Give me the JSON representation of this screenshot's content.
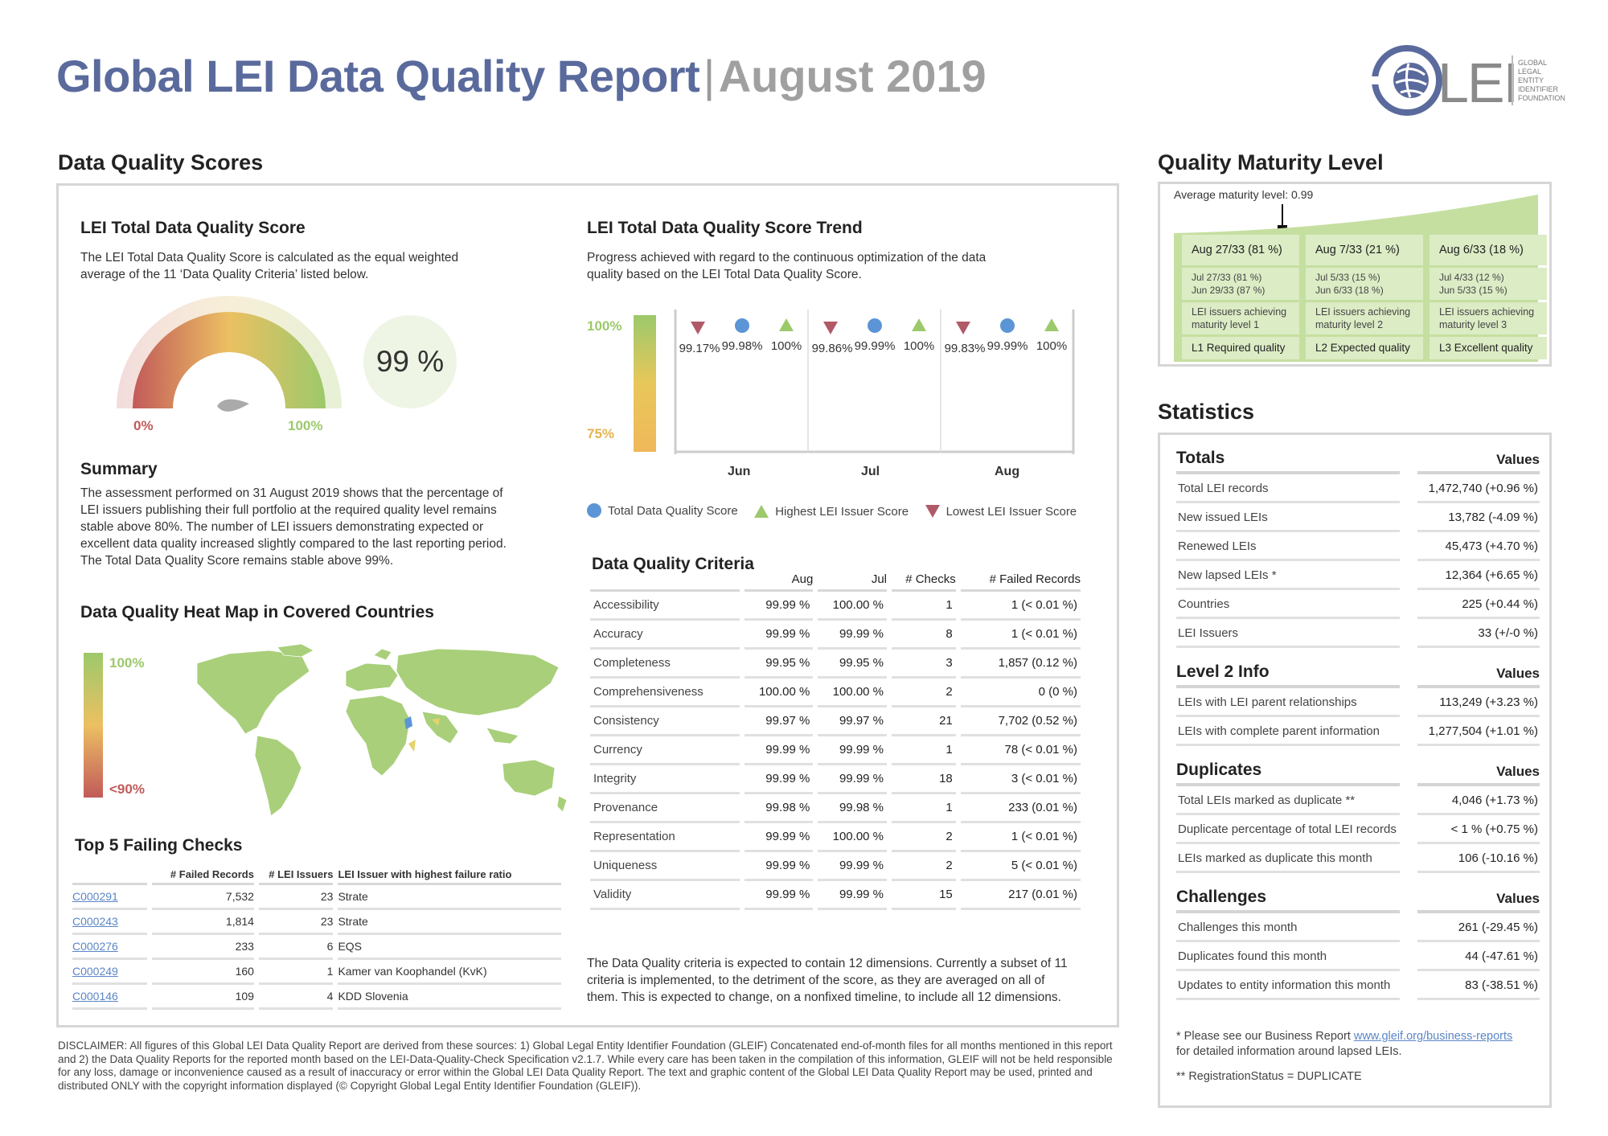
{
  "header": {
    "title": "Global LEI Data Quality Report",
    "separator": "|",
    "month": "August 2019",
    "logo_text": "LEI",
    "logo_sub": [
      "GLOBAL",
      "LEGAL",
      "ENTITY",
      "IDENTIFIER",
      "FOUNDATION"
    ]
  },
  "dq_scores": {
    "heading": "Data Quality Scores",
    "total_score": {
      "title": "LEI Total Data Quality Score",
      "desc": "The LEI Total Data Quality Score is calculated as the equal weighted average of the 11 ‘Data Quality Criteria’ listed below.",
      "gauge_min": "0%",
      "gauge_max": "100%",
      "value_label": "99 %",
      "value": 0.99
    },
    "summary": {
      "title": "Summary",
      "text": "The assessment performed on 31 August 2019 shows that the percentage of LEI issuers publishing their full portfolio at the required quality level remains stable above 80%. The number of LEI issuers demonstrating expected or excellent data quality increased slightly compared to the last reporting period. The Total Data Quality Score remains stable above 99%."
    },
    "heatmap": {
      "title": "Data Quality Heat Map in Covered Countries",
      "scale_top": "100%",
      "scale_bottom": "<90%"
    },
    "top5": {
      "title": "Top 5 Failing Checks",
      "columns": [
        "# Failed Records",
        "# LEI Issuers",
        "LEI Issuer with highest failure ratio"
      ],
      "rows": [
        {
          "check": "C000291",
          "failed": "7,532",
          "issuers": "23",
          "issuer": "Strate"
        },
        {
          "check": "C000243",
          "failed": "1,814",
          "issuers": "23",
          "issuer": "Strate"
        },
        {
          "check": "C000276",
          "failed": "233",
          "issuers": "6",
          "issuer": "EQS"
        },
        {
          "check": "C000249",
          "failed": "160",
          "issuers": "1",
          "issuer": "Kamer van Koophandel (KvK)"
        },
        {
          "check": "C000146",
          "failed": "109",
          "issuers": "4",
          "issuer": "KDD Slovenia"
        }
      ]
    },
    "trend": {
      "title": "LEI Total Data Quality Score Trend",
      "desc": "Progress achieved with regard to the continuous optimization of the data quality based on the LEI Total Data Quality Score.",
      "scale_top": "100%",
      "scale_bottom": "75%",
      "months": [
        "Jun",
        "Jul",
        "Aug"
      ],
      "legend": [
        "Total Data Quality Score",
        "Highest LEI Issuer Score",
        "Lowest LEI Issuer Score"
      ],
      "points": [
        {
          "low": "99.17%",
          "total": "99.98%",
          "high": "100%"
        },
        {
          "low": "99.86%",
          "total": "99.99%",
          "high": "100%"
        },
        {
          "low": "99.83%",
          "total": "99.99%",
          "high": "100%"
        }
      ]
    },
    "criteria": {
      "title": "Data Quality Criteria",
      "columns": [
        "Aug",
        "Jul",
        "# Checks",
        "# Failed Records"
      ],
      "rows": [
        {
          "name": "Accessibility",
          "aug": "99.99 %",
          "jul": "100.00 %",
          "checks": "1",
          "failed": "1 (< 0.01 %)"
        },
        {
          "name": "Accuracy",
          "aug": "99.99 %",
          "jul": "99.99 %",
          "checks": "8",
          "failed": "1 (< 0.01 %)"
        },
        {
          "name": "Completeness",
          "aug": "99.95 %",
          "jul": "99.95 %",
          "checks": "3",
          "failed": "1,857 (0.12 %)"
        },
        {
          "name": "Comprehensiveness",
          "aug": "100.00 %",
          "jul": "100.00 %",
          "checks": "2",
          "failed": "0 (0 %)"
        },
        {
          "name": "Consistency",
          "aug": "99.97 %",
          "jul": "99.97 %",
          "checks": "21",
          "failed": "7,702 (0.52 %)"
        },
        {
          "name": "Currency",
          "aug": "99.99 %",
          "jul": "99.99 %",
          "checks": "1",
          "failed": "78 (< 0.01 %)"
        },
        {
          "name": "Integrity",
          "aug": "99.99 %",
          "jul": "99.99 %",
          "checks": "18",
          "failed": "3 (< 0.01 %)"
        },
        {
          "name": "Provenance",
          "aug": "99.98 %",
          "jul": "99.98 %",
          "checks": "1",
          "failed": "233 (0.01 %)"
        },
        {
          "name": "Representation",
          "aug": "99.99 %",
          "jul": "100.00 %",
          "checks": "2",
          "failed": "1 (< 0.01 %)"
        },
        {
          "name": "Uniqueness",
          "aug": "99.99 %",
          "jul": "99.99 %",
          "checks": "2",
          "failed": "5 (< 0.01 %)"
        },
        {
          "name": "Validity",
          "aug": "99.99 %",
          "jul": "99.99 %",
          "checks": "15",
          "failed": "217 (0.01 %)"
        }
      ],
      "note": "The Data Quality criteria is expected to contain 12 dimensions. Currently a subset of 11 criteria is implemented, to the detriment of the score, as they are averaged on all of them. This is expected to change, on a nonfixed timeline, to include all 12 dimensions."
    }
  },
  "maturity": {
    "heading": "Quality Maturity Level",
    "average": "Average maturity level: 0.99",
    "levels": [
      {
        "head": "Aug 27/33 (81 %)",
        "hist1": "Jul 27/33 (81 %)",
        "hist2": "Jun 29/33 (87 %)",
        "desc1": "LEI issuers achieving",
        "desc2": "maturity level 1",
        "label": "L1 Required quality"
      },
      {
        "head": "Aug 7/33 (21 %)",
        "hist1": "Jul 5/33 (15 %)",
        "hist2": "Jun 6/33 (18 %)",
        "desc1": "LEI issuers achieving",
        "desc2": "maturity level 2",
        "label": "L2 Expected quality"
      },
      {
        "head": "Aug 6/33 (18 %)",
        "hist1": "Jul 4/33 (12 %)",
        "hist2": "Jun 5/33 (15 %)",
        "desc1": "LEI issuers achieving",
        "desc2": "maturity level 3",
        "label": "L3 Excellent quality"
      }
    ]
  },
  "statistics": {
    "heading": "Statistics",
    "values_label": "Values",
    "groups": [
      {
        "title": "Totals",
        "rows": [
          {
            "label": "Total LEI records",
            "value": "1,472,740 (+0.96 %)"
          },
          {
            "label": "New issued LEIs",
            "value": "13,782 (-4.09 %)"
          },
          {
            "label": "Renewed LEIs",
            "value": "45,473 (+4.70 %)"
          },
          {
            "label": "New lapsed LEIs *",
            "value": "12,364 (+6.65 %)"
          },
          {
            "label": "Countries",
            "value": "225 (+0.44 %)"
          },
          {
            "label": "LEI Issuers",
            "value": "33 (+/-0 %)"
          }
        ]
      },
      {
        "title": "Level 2 Info",
        "rows": [
          {
            "label": "LEIs with LEI parent relationships",
            "value": "113,249 (+3.23 %)"
          },
          {
            "label": "LEIs with complete parent information",
            "value": "1,277,504 (+1.01 %)"
          }
        ]
      },
      {
        "title": "Duplicates",
        "rows": [
          {
            "label": "Total LEIs marked as duplicate **",
            "value": "4,046 (+1.73 %)"
          },
          {
            "label": "Duplicate percentage of total LEI records",
            "value": "< 1 % (+0.75 %)"
          },
          {
            "label": "LEIs marked as duplicate this month",
            "value": "106 (-10.16 %)"
          }
        ]
      },
      {
        "title": "Challenges",
        "rows": [
          {
            "label": "Challenges this month",
            "value": "261 (-29.45 %)"
          },
          {
            "label": "Duplicates found this month",
            "value": "44 (-47.61 %)"
          },
          {
            "label": "Updates to entity information this month",
            "value": "83 (-38.51 %)"
          }
        ]
      }
    ],
    "footnote1_prefix": "* Please see our Business Report ",
    "footnote1_link": "www.gleif.org/business-reports",
    "footnote1_suffix": "for detailed information around lapsed LEIs.",
    "footnote2": "** RegistrationStatus = DUPLICATE"
  },
  "disclaimer": "DISCLAIMER: All figures of this Global LEI Data Quality Report are derived from these sources: 1) Global Legal Entity Identifier Foundation (GLEIF) Concatenated end-of-month files for all months mentioned in this report and 2) the Data Quality Reports for the reported month based on the LEI-Data-Quality-Check Specification v2.1.7. While every care has been taken in the compilation of this information, GLEIF will not be held responsible for any loss, damage or inconvenience caused as a result of inaccuracy or error within the Global LEI Data Quality Report. The text and graphic content of the Global LEI Data Quality Report may be used, printed and distributed ONLY with the copyright information displayed (© Copyright Global Legal Entity Identifier Foundation (GLEIF)).",
  "colors": {
    "title_blue": "#5a6a9c",
    "green": "#9cc96b",
    "yellow": "#e8c75a",
    "red": "#c25a5a",
    "marker_blue": "#5b95d6",
    "marker_green": "#9cc96b",
    "marker_red": "#b05a68"
  }
}
